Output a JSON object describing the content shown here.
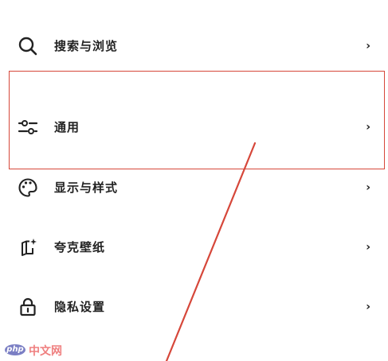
{
  "menu": {
    "items": [
      {
        "label": "搜索与浏览",
        "icon": "search-icon",
        "chevron": "›"
      },
      {
        "label": "通用",
        "icon": "sliders-icon",
        "chevron": "›"
      },
      {
        "label": "显示与样式",
        "icon": "palette-icon",
        "chevron": "›"
      },
      {
        "label": "夸克壁纸",
        "icon": "wallpaper-icon",
        "chevron": "›"
      },
      {
        "label": "隐私设置",
        "icon": "lock-icon",
        "chevron": "›"
      }
    ]
  },
  "annotation": {
    "color": "#d6473a"
  },
  "watermark": {
    "logo": "php",
    "text": "中文网"
  }
}
